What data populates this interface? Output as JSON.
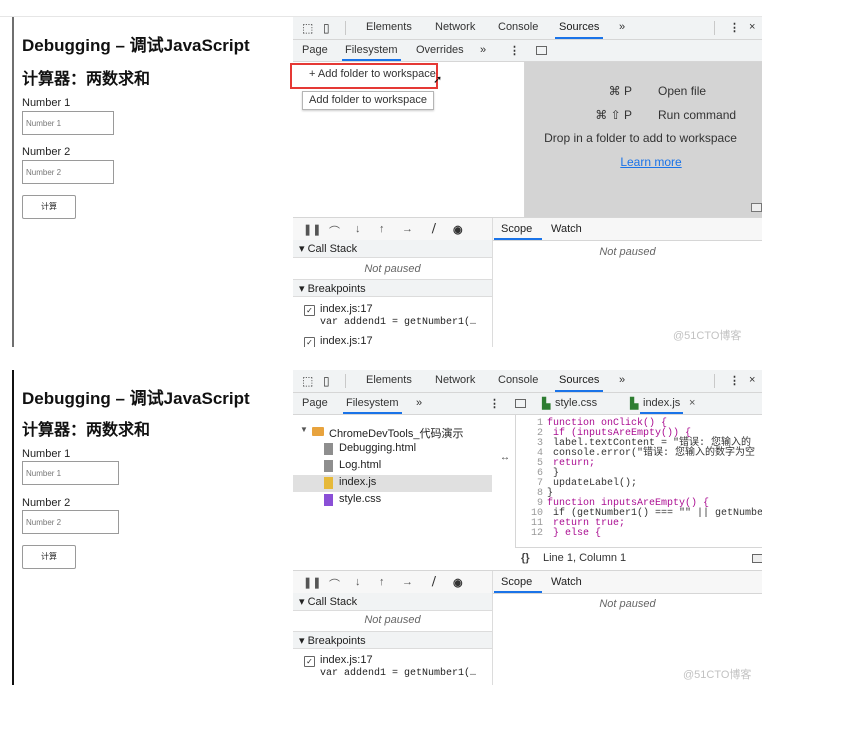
{
  "page": {
    "title": "Debugging – 调试JavaScript",
    "subtitle": "计算器：两数求和",
    "label1": "Number 1",
    "placeholder1": "Number 1",
    "label2": "Number 2",
    "placeholder2": "Number 2",
    "button": "计算"
  },
  "devtools": {
    "tabs": [
      "Elements",
      "Network",
      "Console",
      "Sources",
      "»"
    ],
    "active_tab": "Sources",
    "subtabs_top": [
      "Page",
      "Filesystem",
      "Overrides",
      "»"
    ],
    "subtabs_bottom": [
      "Page",
      "Filesystem",
      "»"
    ],
    "active_subtab": "Filesystem",
    "add_folder": "+ Add folder to workspace",
    "tooltip": "Add folder to workspace",
    "shortcut1_key": "⌘ P",
    "shortcut1_label": "Open file",
    "shortcut2_key": "⌘ ⇧ P",
    "shortcut2_label": "Run command",
    "drop_text": "Drop in a folder to add to workspace",
    "learn_more": "Learn more",
    "debug_tabs": [
      "Scope",
      "Watch"
    ],
    "active_debug_tab": "Scope",
    "not_paused": "Not paused",
    "call_stack": "▾ Call Stack",
    "breakpoints": "▾ Breakpoints",
    "bp1_file": "index.js:17",
    "bp1_code": "var addend1 = getNumber1(…",
    "bp2_file": "index.js:17",
    "watermark": "@51CTO博客",
    "tree": {
      "folder": "ChromeDevTools_代码演示",
      "files": [
        "Debugging.html",
        "Log.html",
        "index.js",
        "style.css"
      ]
    },
    "editor_tabs": [
      "style.css",
      "index.js"
    ],
    "active_editor_tab": "index.js",
    "code_lines": [
      {
        "n": "1",
        "t": "function onClick() {"
      },
      {
        "n": "2",
        "t": "  if (inputsAreEmpty()) {"
      },
      {
        "n": "3",
        "t": "    label.textContent = \"错误: 您输入的"
      },
      {
        "n": "4",
        "t": "    console.error(\"错误: 您输入的数字为空"
      },
      {
        "n": "5",
        "t": "    return;"
      },
      {
        "n": "6",
        "t": "  }"
      },
      {
        "n": "7",
        "t": "  updateLabel();"
      },
      {
        "n": "8",
        "t": "}"
      },
      {
        "n": "9",
        "t": "function inputsAreEmpty() {"
      },
      {
        "n": "10",
        "t": "  if (getNumber1() === \"\" || getNumbe"
      },
      {
        "n": "11",
        "t": "    return true;"
      },
      {
        "n": "12",
        "t": "  } else {"
      }
    ],
    "status": "Line 1, Column 1",
    "status_braces": "{}",
    "highlight_color": "#e53935",
    "accent_color": "#1a73e8"
  }
}
